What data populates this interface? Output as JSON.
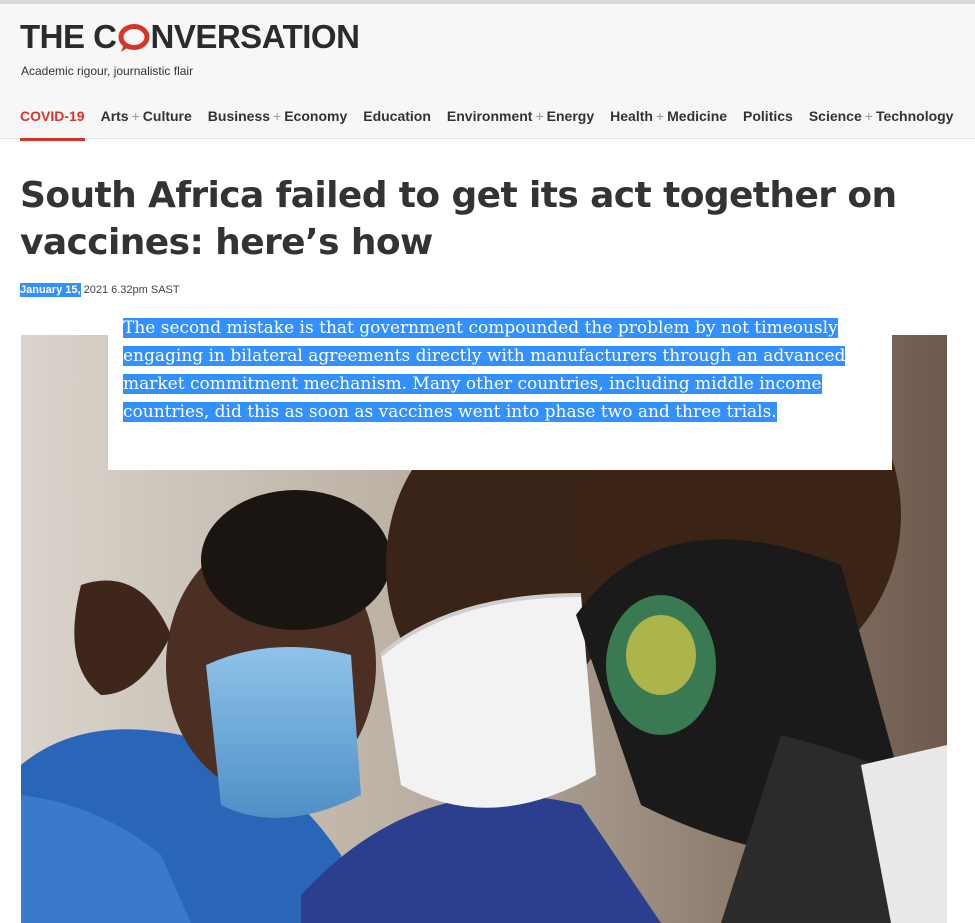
{
  "site": {
    "logo_part1": "THE C",
    "logo_part2": "NVERSATION",
    "logo_icon": "speech-bubble-o-icon",
    "tagline": "Academic rigour, journalistic flair",
    "brand_color": "#d8352a"
  },
  "nav": {
    "items": [
      {
        "a": "COVID-19",
        "b": ""
      },
      {
        "a": "Arts",
        "b": "Culture"
      },
      {
        "a": "Business",
        "b": "Economy"
      },
      {
        "a": "Education",
        "b": ""
      },
      {
        "a": "Environment",
        "b": "Energy"
      },
      {
        "a": "Health",
        "b": "Medicine"
      },
      {
        "a": "Politics",
        "b": ""
      },
      {
        "a": "Science",
        "b": "Technology"
      }
    ],
    "plus": "+"
  },
  "article": {
    "headline": "South Africa failed to get its act together on vaccines: here’s how",
    "date": "January 15,",
    "time": " 2021 6.32pm SAST",
    "hero_image": "three-people-wearing-face-masks"
  },
  "popup": {
    "text": "The second mistake is that government compounded the problem by not timeously engaging in bilateral agreements directly with manufacturers through an advanced market commitment mechanism. Many other countries, including middle income countries, did this as soon as vaccines went into phase two and three trials."
  },
  "colors": {
    "selection": "#3390ff",
    "text": "#333333"
  }
}
